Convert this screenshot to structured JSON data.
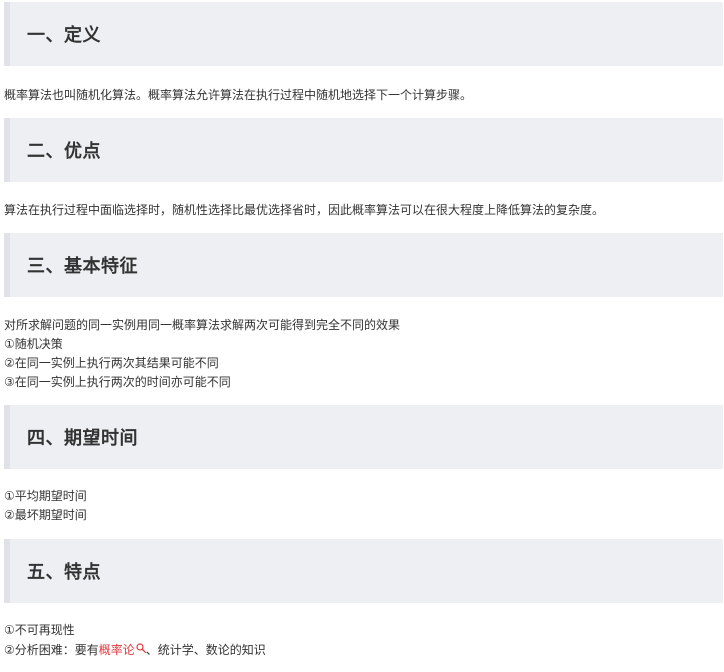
{
  "sections": [
    {
      "title": "一、定义",
      "lines": [
        "概率算法也叫随机化算法。概率算法允许算法在执行过程中随机地选择下一个计算步骤。"
      ]
    },
    {
      "title": "二、优点",
      "lines": [
        "算法在执行过程中面临选择时，随机性选择比最优选择省时，因此概率算法可以在很大程度上降低算法的复杂度。"
      ]
    },
    {
      "title": "三、基本特征",
      "lines": [
        "对所求解问题的同一实例用同一概率算法求解两次可能得到完全不同的效果",
        "①随机决策",
        "②在同一实例上执行两次其结果可能不同",
        "③在同一实例上执行两次的时间亦可能不同"
      ]
    },
    {
      "title": "四、期望时间",
      "lines": [
        "①平均期望时间",
        "②最坏期望时间"
      ]
    },
    {
      "title": "五、特点",
      "lines": [
        "①不可再现性"
      ],
      "last_line": {
        "prefix": "②分析困难：要有",
        "link_text": "概率论",
        "suffix": "、统计学、数论的知识"
      }
    }
  ],
  "colors": {
    "header_bg": "#eeeff3",
    "header_border": "#e0e2e8",
    "text": "#333333",
    "link": "#e0393e"
  }
}
